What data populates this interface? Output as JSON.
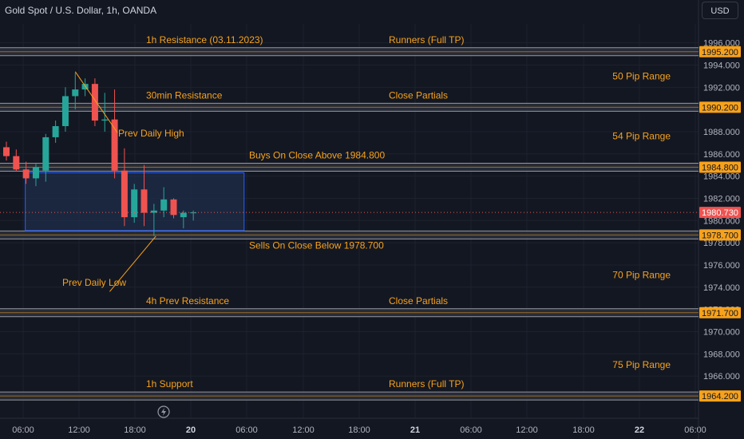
{
  "header": {
    "symbol_title": "Gold Spot / U.S. Dollar, 1h, OANDA",
    "currency_button": "USD"
  },
  "colors": {
    "background": "#131722",
    "axis_text": "#b2b5be",
    "grid": "#1e222d",
    "level_band": "#2a2e39",
    "level_line": "#9598a1",
    "annotation": "#f7a21b",
    "up": "#26a69a",
    "down": "#ef5350",
    "zone_fill": "#1f2d4a",
    "zone_border": "#2962ff"
  },
  "chart_data": {
    "type": "candlestick",
    "y_range": [
      1962.2,
      1997.7
    ],
    "y_ticks": [
      1996.0,
      1994.0,
      1992.0,
      1990.0,
      1988.0,
      1986.0,
      1984.0,
      1982.0,
      1980.0,
      1978.0,
      1976.0,
      1974.0,
      1972.0,
      1970.0,
      1968.0,
      1966.0
    ],
    "x_tick_labels": [
      "06:00",
      "12:00",
      "18:00",
      "20",
      "06:00",
      "12:00",
      "18:00",
      "21",
      "06:00",
      "12:00",
      "18:00",
      "22",
      "06:00"
    ],
    "bars_visible": 71,
    "candles": [
      {
        "i": 0,
        "o": 1986.6,
        "h": 1987.1,
        "l": 1985.4,
        "c": 1985.8
      },
      {
        "i": 1,
        "o": 1985.8,
        "h": 1986.4,
        "l": 1984.4,
        "c": 1984.6
      },
      {
        "i": 2,
        "o": 1984.6,
        "h": 1985.3,
        "l": 1983.3,
        "c": 1983.8
      },
      {
        "i": 3,
        "o": 1983.8,
        "h": 1985.1,
        "l": 1983.1,
        "c": 1984.8
      },
      {
        "i": 4,
        "o": 1984.5,
        "h": 1987.8,
        "l": 1983.5,
        "c": 1987.5
      },
      {
        "i": 5,
        "o": 1987.5,
        "h": 1989.0,
        "l": 1987.0,
        "c": 1988.5
      },
      {
        "i": 6,
        "o": 1988.5,
        "h": 1992.0,
        "l": 1988.0,
        "c": 1991.2
      },
      {
        "i": 7,
        "o": 1991.2,
        "h": 1993.3,
        "l": 1990.0,
        "c": 1991.8
      },
      {
        "i": 8,
        "o": 1991.8,
        "h": 1992.8,
        "l": 1991.2,
        "c": 1992.3
      },
      {
        "i": 9,
        "o": 1992.3,
        "h": 1992.8,
        "l": 1988.5,
        "c": 1989.0
      },
      {
        "i": 10,
        "o": 1989.0,
        "h": 1991.5,
        "l": 1988.0,
        "c": 1989.1
      },
      {
        "i": 11,
        "o": 1989.1,
        "h": 1991.8,
        "l": 1983.8,
        "c": 1984.5
      },
      {
        "i": 12,
        "o": 1984.5,
        "h": 1986.5,
        "l": 1979.5,
        "c": 1980.3
      },
      {
        "i": 13,
        "o": 1980.3,
        "h": 1983.3,
        "l": 1979.8,
        "c": 1982.8
      },
      {
        "i": 14,
        "o": 1982.8,
        "h": 1985.0,
        "l": 1979.5,
        "c": 1980.7
      },
      {
        "i": 15,
        "o": 1980.7,
        "h": 1981.5,
        "l": 1978.6,
        "c": 1980.9
      },
      {
        "i": 16,
        "o": 1980.9,
        "h": 1983.0,
        "l": 1980.3,
        "c": 1981.9
      },
      {
        "i": 17,
        "o": 1981.9,
        "h": 1982.0,
        "l": 1980.2,
        "c": 1980.5
      },
      {
        "i": 18,
        "o": 1980.3,
        "h": 1980.9,
        "l": 1979.3,
        "c": 1980.7
      },
      {
        "i": 19,
        "o": 1980.7,
        "h": 1980.9,
        "l": 1980.0,
        "c": 1980.73
      }
    ],
    "levels": [
      {
        "price": 1995.2,
        "label": "1995.200",
        "left_text": "1h Resistance (03.11.2023)",
        "right_text": "Runners (Full TP)"
      },
      {
        "price": 1990.2,
        "label": "1990.200",
        "left_text": "30min Resistance",
        "right_text": "Close Partials"
      },
      {
        "price": 1984.8,
        "label": "1984.800",
        "left_text": "Buys On Close Above 1984.800",
        "right_text": ""
      },
      {
        "price": 1978.7,
        "label": "1978.700",
        "left_text": "Sells On Close Below 1978.700",
        "right_text": ""
      },
      {
        "price": 1971.7,
        "label": "1971.700",
        "left_text": "4h Prev Resistance",
        "right_text": "Close Partials"
      },
      {
        "price": 1964.2,
        "label": "1964.200",
        "left_text": "1h Support",
        "right_text": "Runners (Full TP)"
      }
    ],
    "range_notes": [
      {
        "text": "50 Pip Range",
        "price": 1993.0
      },
      {
        "text": "54 Pip Range",
        "price": 1987.6
      },
      {
        "text": "70 Pip Range",
        "price": 1975.1
      },
      {
        "text": "75 Pip Range",
        "price": 1967.0
      }
    ],
    "callouts": [
      {
        "text": "Prev Daily High",
        "from_bar": 7,
        "from_price": 1993.4,
        "to_bar": 11.3,
        "to_price": 1987.9
      },
      {
        "text": "Prev Daily Low",
        "from_bar": 15.2,
        "from_price": 1978.6,
        "to_bar": 10.5,
        "to_price": 1973.6
      }
    ],
    "zone": {
      "from_bar": 2,
      "to_bar": 24,
      "price_high": 1984.3,
      "price_low": 1979.1
    },
    "last_price": {
      "value": 1980.73,
      "label": "1980.730"
    }
  }
}
